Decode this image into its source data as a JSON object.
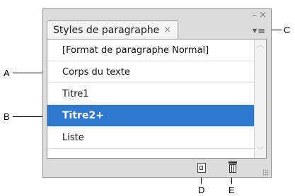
{
  "panel": {
    "tab_label": "Styles de paragraphe",
    "tab_close": "×",
    "minimize": "–",
    "close": "×",
    "menu_icon": "panel-menu-icon",
    "items": [
      "[Format de paragraphe Normal]",
      "Corps du texte",
      "Titre1",
      "Titre2+",
      "Liste"
    ],
    "selected_index": 3,
    "selection_color": "#2f78cf"
  },
  "callouts": {
    "a": "A",
    "b": "B",
    "c": "C",
    "d": "D",
    "e": "E"
  },
  "icons": {
    "new": "new-style-icon",
    "delete": "trash-icon"
  }
}
